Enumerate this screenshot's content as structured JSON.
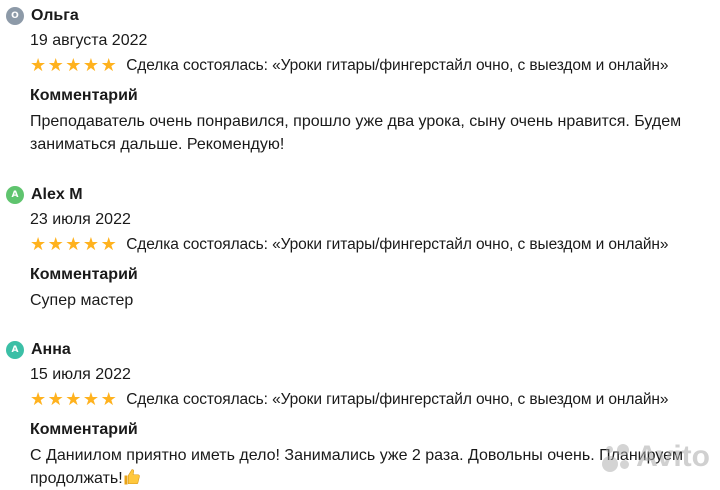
{
  "reviews": [
    {
      "avatar_letter": "О",
      "avatar_color": "#8d9aa8",
      "name": "Ольга",
      "date": "19 августа 2022",
      "rating": 5,
      "deal_text": "Сделка состоялась: «Уроки гитары/фингерстайл очно, с выездом и онлайн»",
      "comment_title": "Комментарий",
      "comment": "Преподаватель очень понравился, прошло уже два урока, сыну очень нравится. Будем заниматься дальше. Рекомендую!"
    },
    {
      "avatar_letter": "A",
      "avatar_color": "#5fc46e",
      "name": "Alex M",
      "date": "23 июля 2022",
      "rating": 5,
      "deal_text": "Сделка состоялась: «Уроки гитары/фингерстайл очно, с выездом и онлайн»",
      "comment_title": "Комментарий",
      "comment": "Супер мастер"
    },
    {
      "avatar_letter": "А",
      "avatar_color": "#3bbfa6",
      "name": "Анна",
      "date": "15 июля 2022",
      "rating": 5,
      "deal_text": "Сделка состоялась: «Уроки гитары/фингерстайл очно, с выездом и онлайн»",
      "comment_title": "Комментарий",
      "comment": "С Даниилом приятно иметь дело! Занимались уже 2 раза. Довольны очень. Планируем продолжать!",
      "comment_emoji": "thumbs-up-icon"
    }
  ],
  "star_color": "#ffb21e",
  "watermark": {
    "text": "Avito"
  }
}
